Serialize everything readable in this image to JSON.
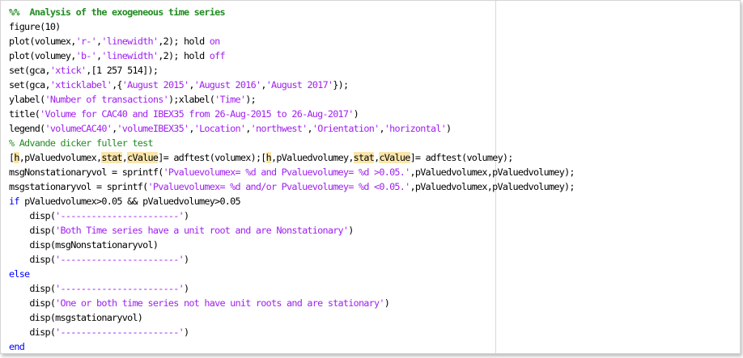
{
  "colors": {
    "keyword": "#0000ff",
    "string": "#a020f0",
    "comment": "#228b22",
    "highlight": "#fae6ad",
    "text": "#000000"
  },
  "lines": [
    [
      {
        "t": "%%  Analysis of the exogeneous time series",
        "s": "cell"
      }
    ],
    [
      {
        "t": "figure(10)",
        "s": "plain"
      }
    ],
    [
      {
        "t": "plot(volumex,",
        "s": "plain"
      },
      {
        "t": "'r-'",
        "s": "str"
      },
      {
        "t": ",",
        "s": "plain"
      },
      {
        "t": "'linewidth'",
        "s": "str"
      },
      {
        "t": ",2); hold ",
        "s": "plain"
      },
      {
        "t": "on",
        "s": "str"
      }
    ],
    [
      {
        "t": "plot(volumey,",
        "s": "plain"
      },
      {
        "t": "'b-'",
        "s": "str"
      },
      {
        "t": ",",
        "s": "plain"
      },
      {
        "t": "'linewidth'",
        "s": "str"
      },
      {
        "t": ",2); hold ",
        "s": "plain"
      },
      {
        "t": "off",
        "s": "str"
      }
    ],
    [
      {
        "t": "set(gca,",
        "s": "plain"
      },
      {
        "t": "'xtick'",
        "s": "str"
      },
      {
        "t": ",[1 257 514]);",
        "s": "plain"
      }
    ],
    [
      {
        "t": "set(gca,",
        "s": "plain"
      },
      {
        "t": "'xticklabel'",
        "s": "str"
      },
      {
        "t": ",{",
        "s": "plain"
      },
      {
        "t": "'August 2015'",
        "s": "str"
      },
      {
        "t": ",",
        "s": "plain"
      },
      {
        "t": "'August 2016'",
        "s": "str"
      },
      {
        "t": ",",
        "s": "plain"
      },
      {
        "t": "'August 2017'",
        "s": "str"
      },
      {
        "t": "});",
        "s": "plain"
      }
    ],
    [
      {
        "t": "ylabel(",
        "s": "plain"
      },
      {
        "t": "'Number of transactions'",
        "s": "str"
      },
      {
        "t": ");xlabel(",
        "s": "plain"
      },
      {
        "t": "'Time'",
        "s": "str"
      },
      {
        "t": ");",
        "s": "plain"
      }
    ],
    [
      {
        "t": "title(",
        "s": "plain"
      },
      {
        "t": "'Volume for CAC40 and IBEX35 from 26-Aug-2015 to 26-Aug-2017'",
        "s": "str"
      },
      {
        "t": ")",
        "s": "plain"
      }
    ],
    [
      {
        "t": "legend(",
        "s": "plain"
      },
      {
        "t": "'volumeCAC40'",
        "s": "str"
      },
      {
        "t": ",",
        "s": "plain"
      },
      {
        "t": "'volumeIBEX35'",
        "s": "str"
      },
      {
        "t": ",",
        "s": "plain"
      },
      {
        "t": "'Location'",
        "s": "str"
      },
      {
        "t": ",",
        "s": "plain"
      },
      {
        "t": "'northwest'",
        "s": "str"
      },
      {
        "t": ",",
        "s": "plain"
      },
      {
        "t": "'Orientation'",
        "s": "str"
      },
      {
        "t": ",",
        "s": "plain"
      },
      {
        "t": "'horizontal'",
        "s": "str"
      },
      {
        "t": ")",
        "s": "plain"
      }
    ],
    [
      {
        "t": "% Advande dicker fuller test",
        "s": "com"
      }
    ],
    [
      {
        "t": "[",
        "s": "plain"
      },
      {
        "t": "h",
        "s": "hl"
      },
      {
        "t": ",pValuedvolumex,",
        "s": "plain"
      },
      {
        "t": "stat",
        "s": "hl"
      },
      {
        "t": ",",
        "s": "plain"
      },
      {
        "t": "cValue",
        "s": "hl"
      },
      {
        "t": "]= adftest(volumex);[",
        "s": "plain"
      },
      {
        "t": "h",
        "s": "hl"
      },
      {
        "t": ",pValuedvolumey,",
        "s": "plain"
      },
      {
        "t": "stat",
        "s": "hl"
      },
      {
        "t": ",",
        "s": "plain"
      },
      {
        "t": "cValue",
        "s": "hl"
      },
      {
        "t": "]= adftest(volumey);",
        "s": "plain"
      }
    ],
    [
      {
        "t": "msgNonstationaryvol = sprintf(",
        "s": "plain"
      },
      {
        "t": "'Pvaluevolumex= %d and Pvaluevolumey= %d >0.05.'",
        "s": "str"
      },
      {
        "t": ",pValuedvolumex,pValuedvolumey);",
        "s": "plain"
      }
    ],
    [
      {
        "t": "msgstationaryvol = sprintf(",
        "s": "plain"
      },
      {
        "t": "'Pvaluevolumex= %d and/or Pvaluevolumey= %d <0.05.'",
        "s": "str"
      },
      {
        "t": ",pValuedvolumex,pValuedvolumey);",
        "s": "plain"
      }
    ],
    [
      {
        "t": "if",
        "s": "kw"
      },
      {
        "t": " pValuedvolumex>0.05 && pValuedvolumey>0.05",
        "s": "plain"
      }
    ],
    [
      {
        "t": "    disp(",
        "s": "plain"
      },
      {
        "t": "'-----------------------'",
        "s": "str"
      },
      {
        "t": ")",
        "s": "plain"
      }
    ],
    [
      {
        "t": "    disp(",
        "s": "plain"
      },
      {
        "t": "'Both Time series have a unit root and are Nonstationary'",
        "s": "str"
      },
      {
        "t": ")",
        "s": "plain"
      }
    ],
    [
      {
        "t": "    disp(msgNonstationaryvol)",
        "s": "plain"
      }
    ],
    [
      {
        "t": "    disp(",
        "s": "plain"
      },
      {
        "t": "'-----------------------'",
        "s": "str"
      },
      {
        "t": ")",
        "s": "plain"
      }
    ],
    [
      {
        "t": "else",
        "s": "kw"
      }
    ],
    [
      {
        "t": "    disp(",
        "s": "plain"
      },
      {
        "t": "'-----------------------'",
        "s": "str"
      },
      {
        "t": ")",
        "s": "plain"
      }
    ],
    [
      {
        "t": "    disp(",
        "s": "plain"
      },
      {
        "t": "'One or both time series not have unit roots and are stationary'",
        "s": "str"
      },
      {
        "t": ")",
        "s": "plain"
      }
    ],
    [
      {
        "t": "    disp(msgstationaryvol)",
        "s": "plain"
      }
    ],
    [
      {
        "t": "    disp(",
        "s": "plain"
      },
      {
        "t": "'-----------------------'",
        "s": "str"
      },
      {
        "t": ")",
        "s": "plain"
      }
    ],
    [
      {
        "t": "end",
        "s": "kw"
      }
    ]
  ]
}
